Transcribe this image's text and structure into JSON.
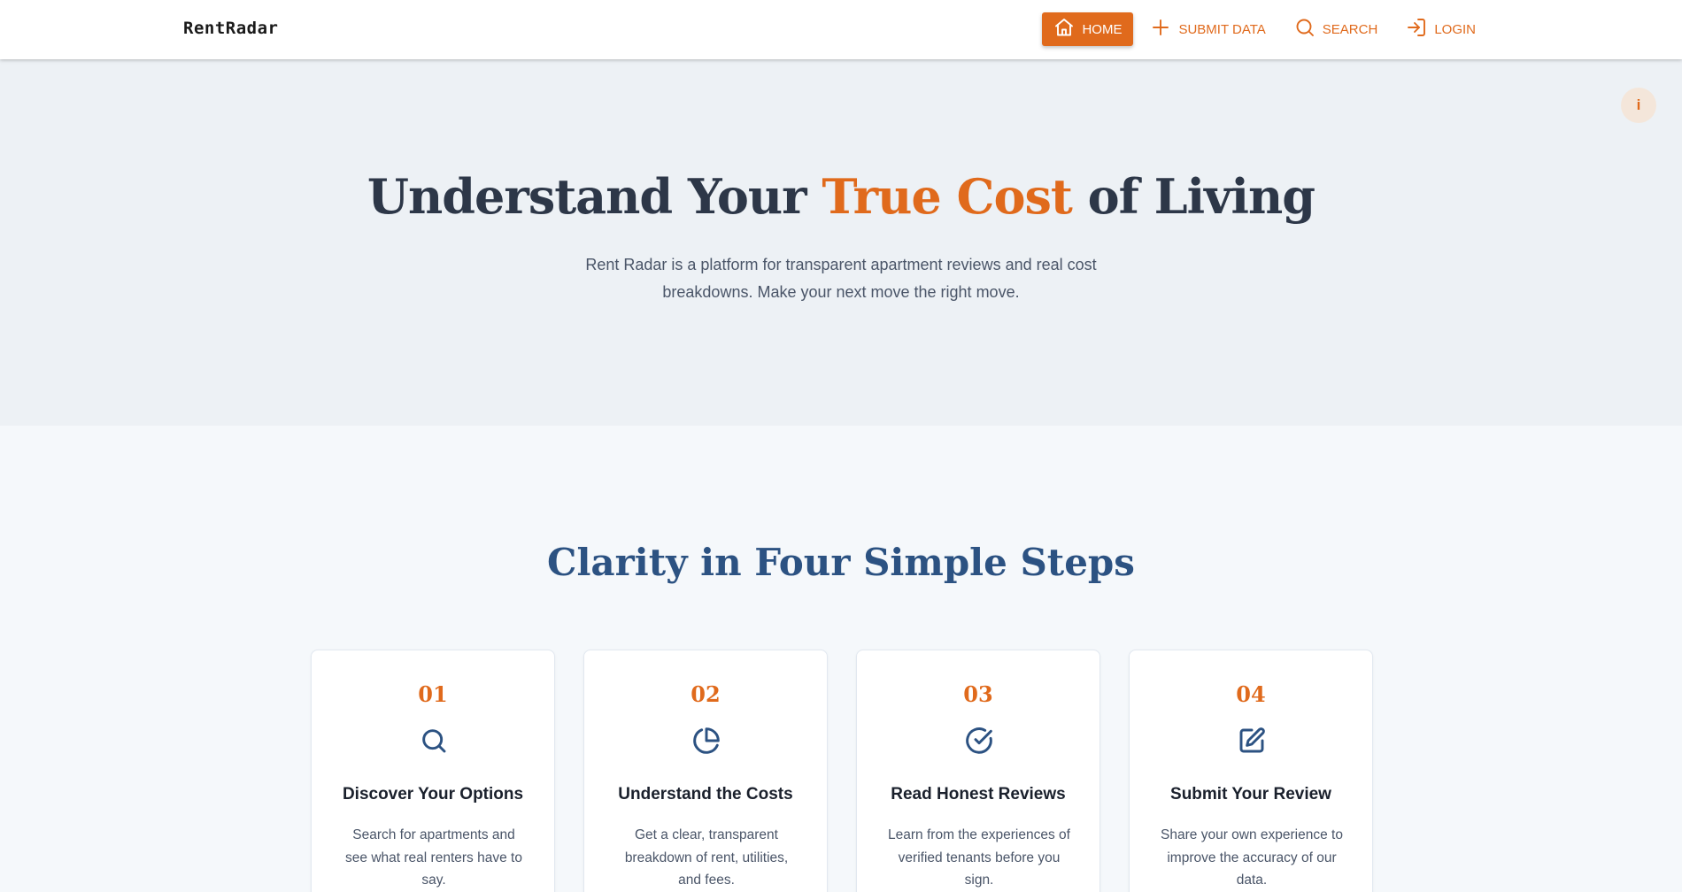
{
  "brand": "RentRadar",
  "nav": {
    "home": "HOME",
    "submit": "SUBMIT DATA",
    "search": "SEARCH",
    "login": "LOGIN"
  },
  "info_button": "i",
  "hero": {
    "title_before": "Understand Your ",
    "title_accent": "True Cost",
    "title_after": " of Living",
    "subtitle": "Rent Radar is a platform for transparent apartment reviews and real cost breakdowns. Make your next move the right move."
  },
  "steps": {
    "title": "Clarity in Four Simple Steps",
    "items": [
      {
        "number": "01",
        "icon": "search-icon",
        "title": "Discover Your Options",
        "description": "Search for apartments and see what real renters have to say."
      },
      {
        "number": "02",
        "icon": "pie-chart-icon",
        "title": "Understand the Costs",
        "description": "Get a clear, transparent breakdown of rent, utilities, and fees."
      },
      {
        "number": "03",
        "icon": "check-circle-icon",
        "title": "Read Honest Reviews",
        "description": "Learn from the experiences of verified tenants before you sign."
      },
      {
        "number": "04",
        "icon": "edit-icon",
        "title": "Submit Your Review",
        "description": "Share your own experience to improve the accuracy of our data."
      }
    ]
  },
  "colors": {
    "accent": "#e06a1c",
    "heading_blue": "#2c5282",
    "dark_text": "#2d3748"
  }
}
